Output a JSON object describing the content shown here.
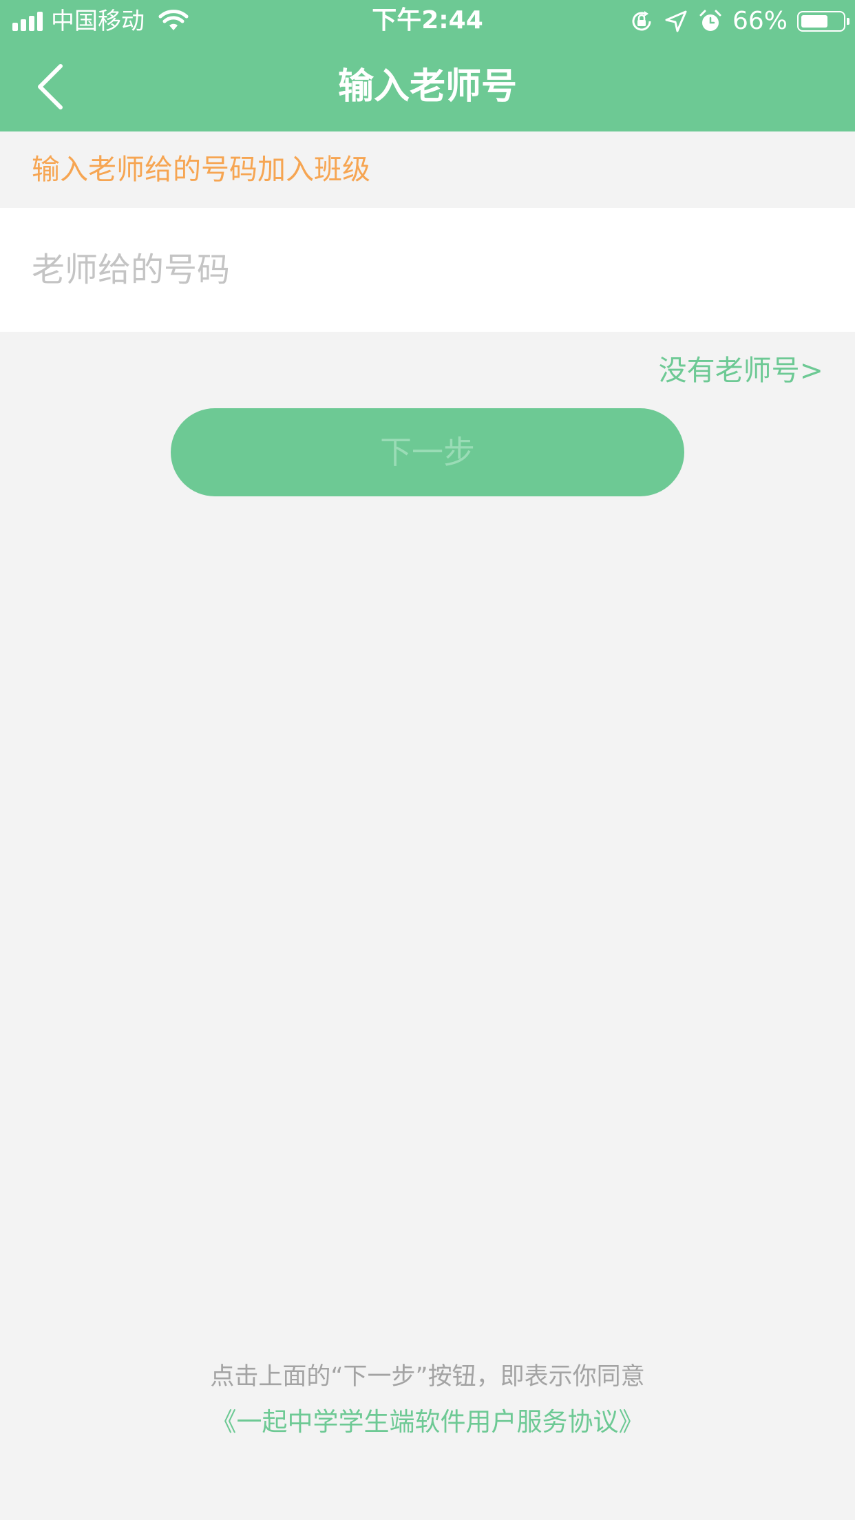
{
  "status_bar": {
    "carrier": "中国移动",
    "time": "下午2:44",
    "battery_percent_label": "66%",
    "battery_level": 0.66,
    "signal_bars": 4,
    "icons": [
      "signal-icon",
      "wifi-icon",
      "rotation-lock-icon",
      "location-icon",
      "alarm-icon",
      "battery-icon"
    ]
  },
  "nav": {
    "title": "输入老师号",
    "back_icon": "chevron-left-icon"
  },
  "main": {
    "hint": "输入老师给的号码加入班级",
    "input_placeholder": "老师给的号码",
    "input_value": "",
    "no_teacher_link": "没有老师号>",
    "next_button": "下一步"
  },
  "footer": {
    "agreement_text": "点击上面的“下一步”按钮，即表示你同意",
    "agreement_link": "《一起中学学生端软件用户服务协议》"
  },
  "colors": {
    "primary_green": "#6dc994",
    "hint_orange": "#f6a552",
    "background": "#f3f3f3",
    "disabled_text": "#9adcb6"
  }
}
